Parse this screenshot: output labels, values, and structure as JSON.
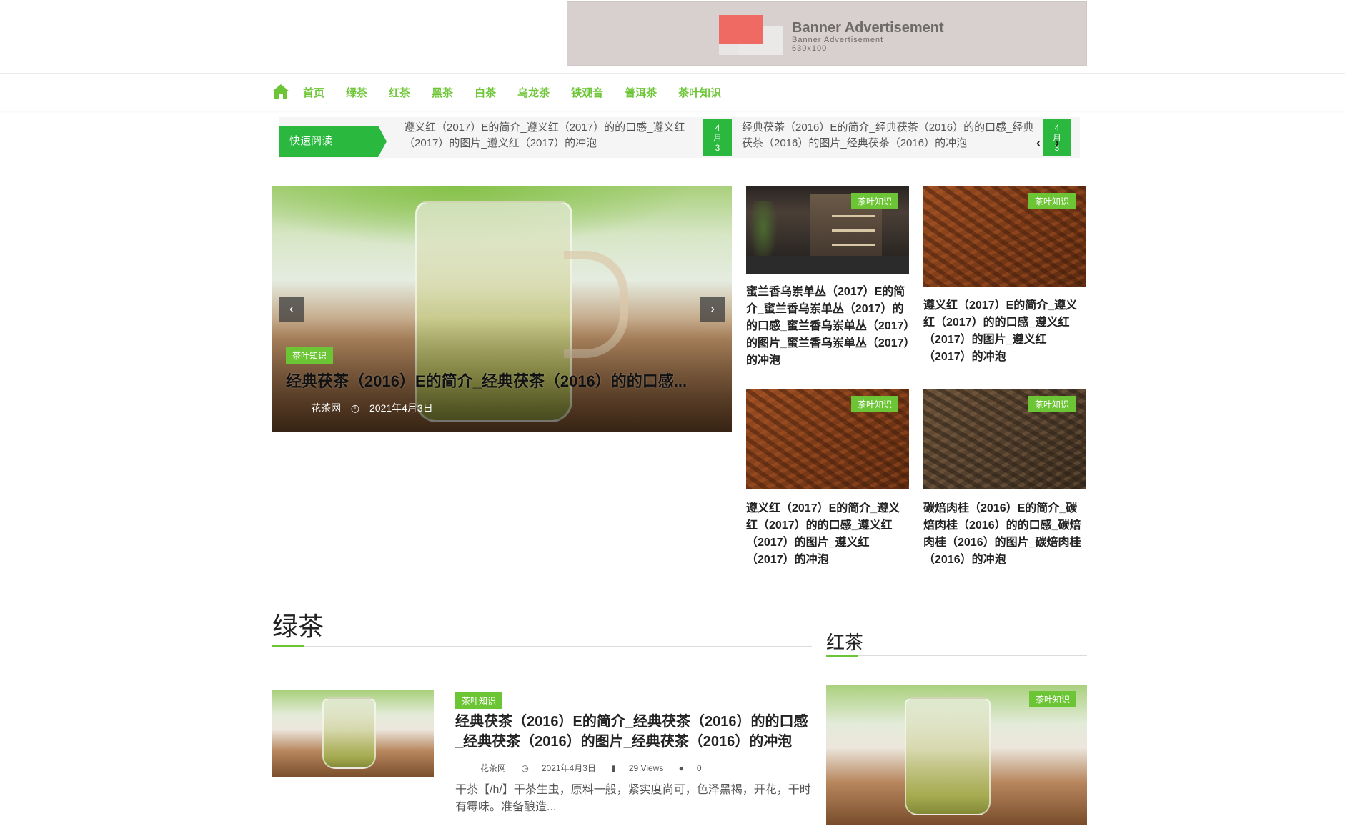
{
  "banner": {
    "title": "Banner Advertisement",
    "subtitle": "Banner Advertisement",
    "size": "630x100"
  },
  "nav": {
    "home_icon": "home-icon",
    "items": [
      "首页",
      "绿茶",
      "红茶",
      "黑茶",
      "白茶",
      "乌龙茶",
      "铁观音",
      "普洱茶",
      "茶叶知识"
    ],
    "color": "#6cc534"
  },
  "ticker": {
    "label": "快速阅读",
    "items": [
      {
        "text": "遵义红（2017）E的简介_遵义红（2017）的的口感_遵义红（2017）的图片_遵义红（2017）的冲泡",
        "date_day": "4",
        "date_month": "月",
        "date_num": "3"
      },
      {
        "text": "经典茯茶（2016）E的简介_经典茯茶（2016）的的口感_经典茯茶（2016）的图片_经典茯茶（2016）的冲泡",
        "date_day": "4",
        "date_month": "月",
        "date_num": "3"
      }
    ],
    "prev": "‹",
    "next": "›"
  },
  "hero": {
    "tag": "茶叶知识",
    "title": "经典茯茶（2016）E的简介_经典茯茶（2016）的的口感...",
    "author": "花茶网",
    "date": "2021年4月3日",
    "prev": "‹",
    "next": "›"
  },
  "grid": [
    {
      "tag": "茶叶知识",
      "title": "蜜兰香乌岽单丛（2017）E的简介_蜜兰香乌岽单丛（2017）的的口感_蜜兰香乌岽单丛（2017）的图片_蜜兰香乌岽单丛（2017）的冲泡"
    },
    {
      "tag": "茶叶知识",
      "title": "遵义红（2017）E的简介_遵义红（2017）的的口感_遵义红（2017）的图片_遵义红（2017）的冲泡"
    },
    {
      "tag": "茶叶知识",
      "title": "遵义红（2017）E的简介_遵义红（2017）的的口感_遵义红（2017）的图片_遵义红（2017）的冲泡"
    },
    {
      "tag": "茶叶知识",
      "title": "碳焙肉桂（2016）E的简介_碳焙肉桂（2016）的的口感_碳焙肉桂（2016）的图片_碳焙肉桂（2016）的冲泡"
    }
  ],
  "green_section": {
    "title": "绿茶",
    "post": {
      "tag": "茶叶知识",
      "title": "经典茯茶（2016）E的简介_经典茯茶（2016）的的口感_经典茯茶（2016）的图片_经典茯茶（2016）的冲泡",
      "author": "花茶网",
      "date": "2021年4月3日",
      "views": "29 Views",
      "comments": "0",
      "excerpt": "干茶【/h/】干茶生虫，原料一般，紧实度尚可，色泽黑褐，开花，干时有霉味。准备酿造..."
    }
  },
  "red_section": {
    "title": "红茶",
    "tag": "茶叶知识"
  }
}
